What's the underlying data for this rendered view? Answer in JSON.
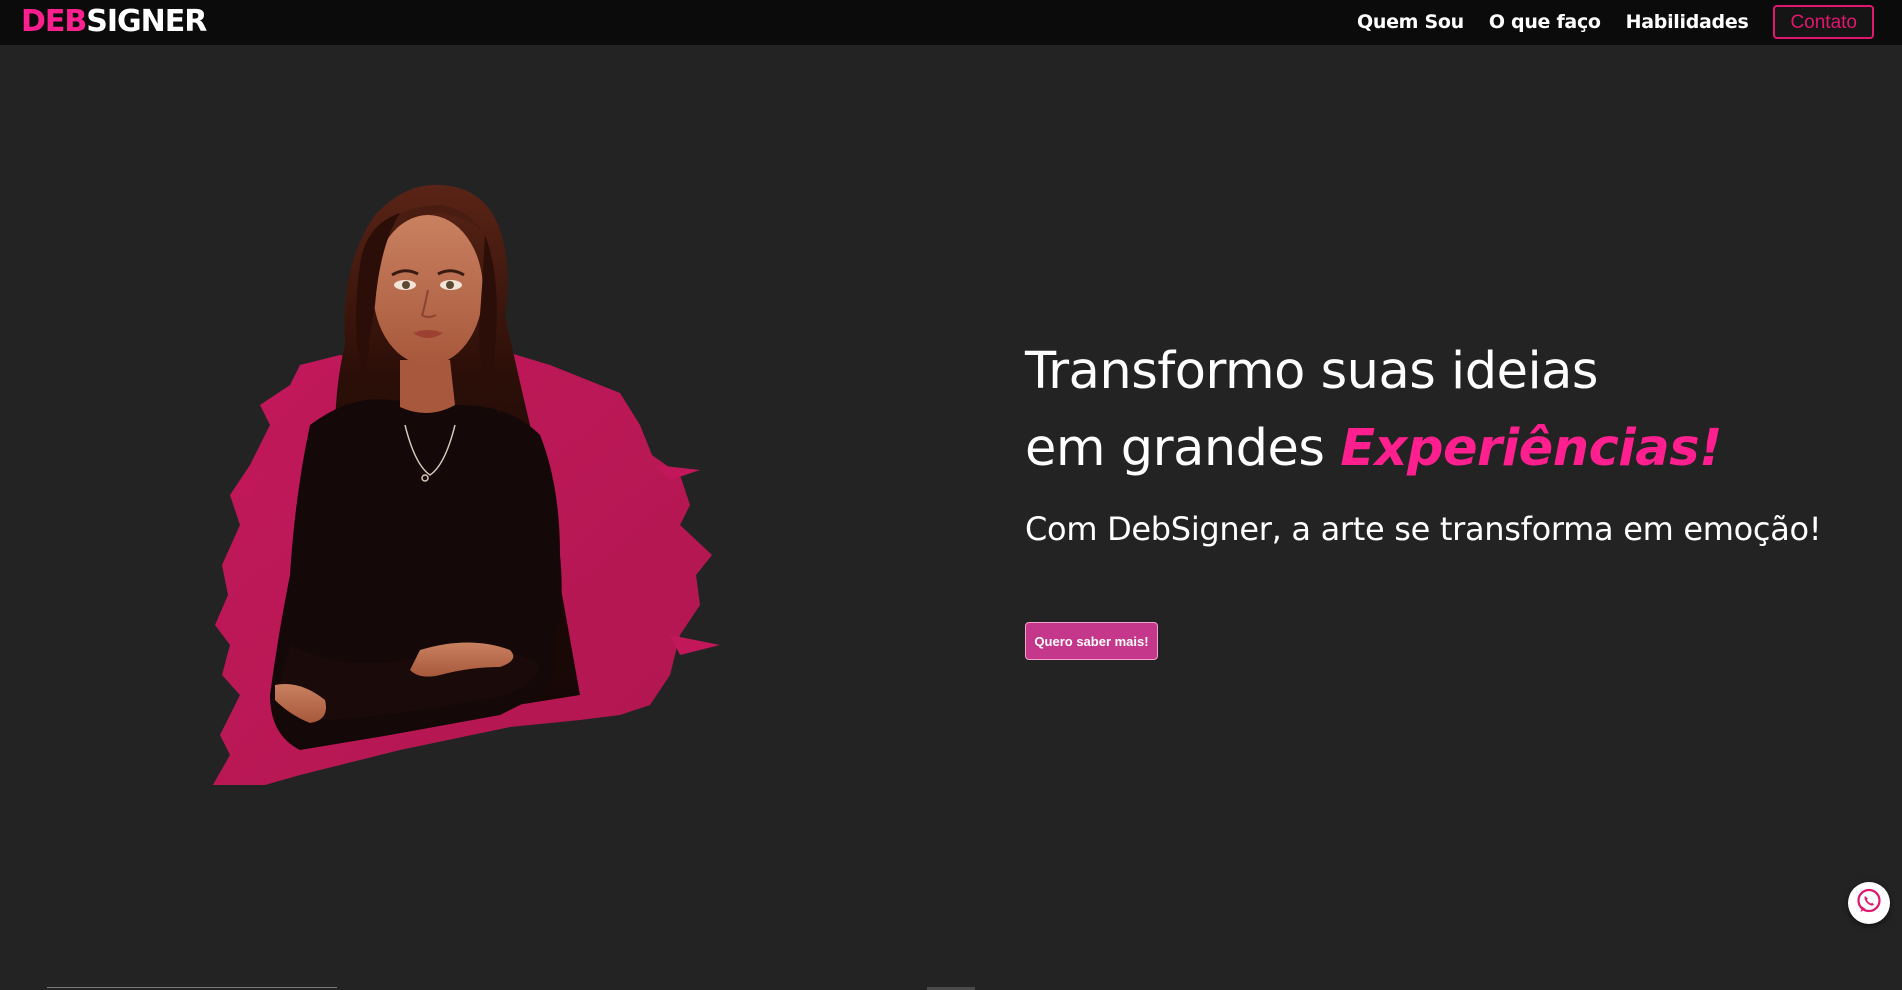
{
  "header": {
    "logo_part1": "DEB",
    "logo_part2": "SIGNER",
    "nav": [
      {
        "label": "Quem Sou"
      },
      {
        "label": "O que faço"
      },
      {
        "label": "Habilidades"
      }
    ],
    "contact_label": "Contato"
  },
  "hero": {
    "headline_line1": "Transformo suas ideias",
    "headline_line2_prefix": "em grandes ",
    "headline_line2_accent": "Experiências!",
    "subline": "Com DebSigner, a arte se transforma em emoção!",
    "cta_label": "Quero saber mais!"
  },
  "colors": {
    "background": "#232323",
    "navbar": "#0b0b0b",
    "accent": "#ff1f8f",
    "cta": "#c5378a"
  },
  "icons": {
    "floating": "whatsapp-icon"
  }
}
